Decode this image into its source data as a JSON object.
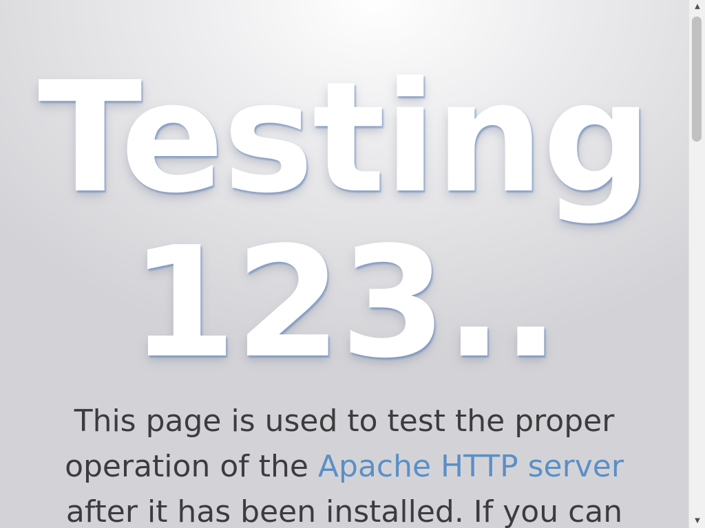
{
  "hero": {
    "line1": "Testing",
    "line2": "123.."
  },
  "intro": {
    "line1": "This page is used to test the proper",
    "line2_prefix": "operation of the ",
    "line2_link": "Apache HTTP server",
    "line3": "after it has been installed. If you can"
  },
  "colors": {
    "link": "#5b8fc7",
    "text": "#3c3c3e",
    "hero_text": "#ffffff"
  },
  "scrollbar": {
    "up_icon": "triangle-up-icon",
    "down_icon": "triangle-down-icon"
  }
}
